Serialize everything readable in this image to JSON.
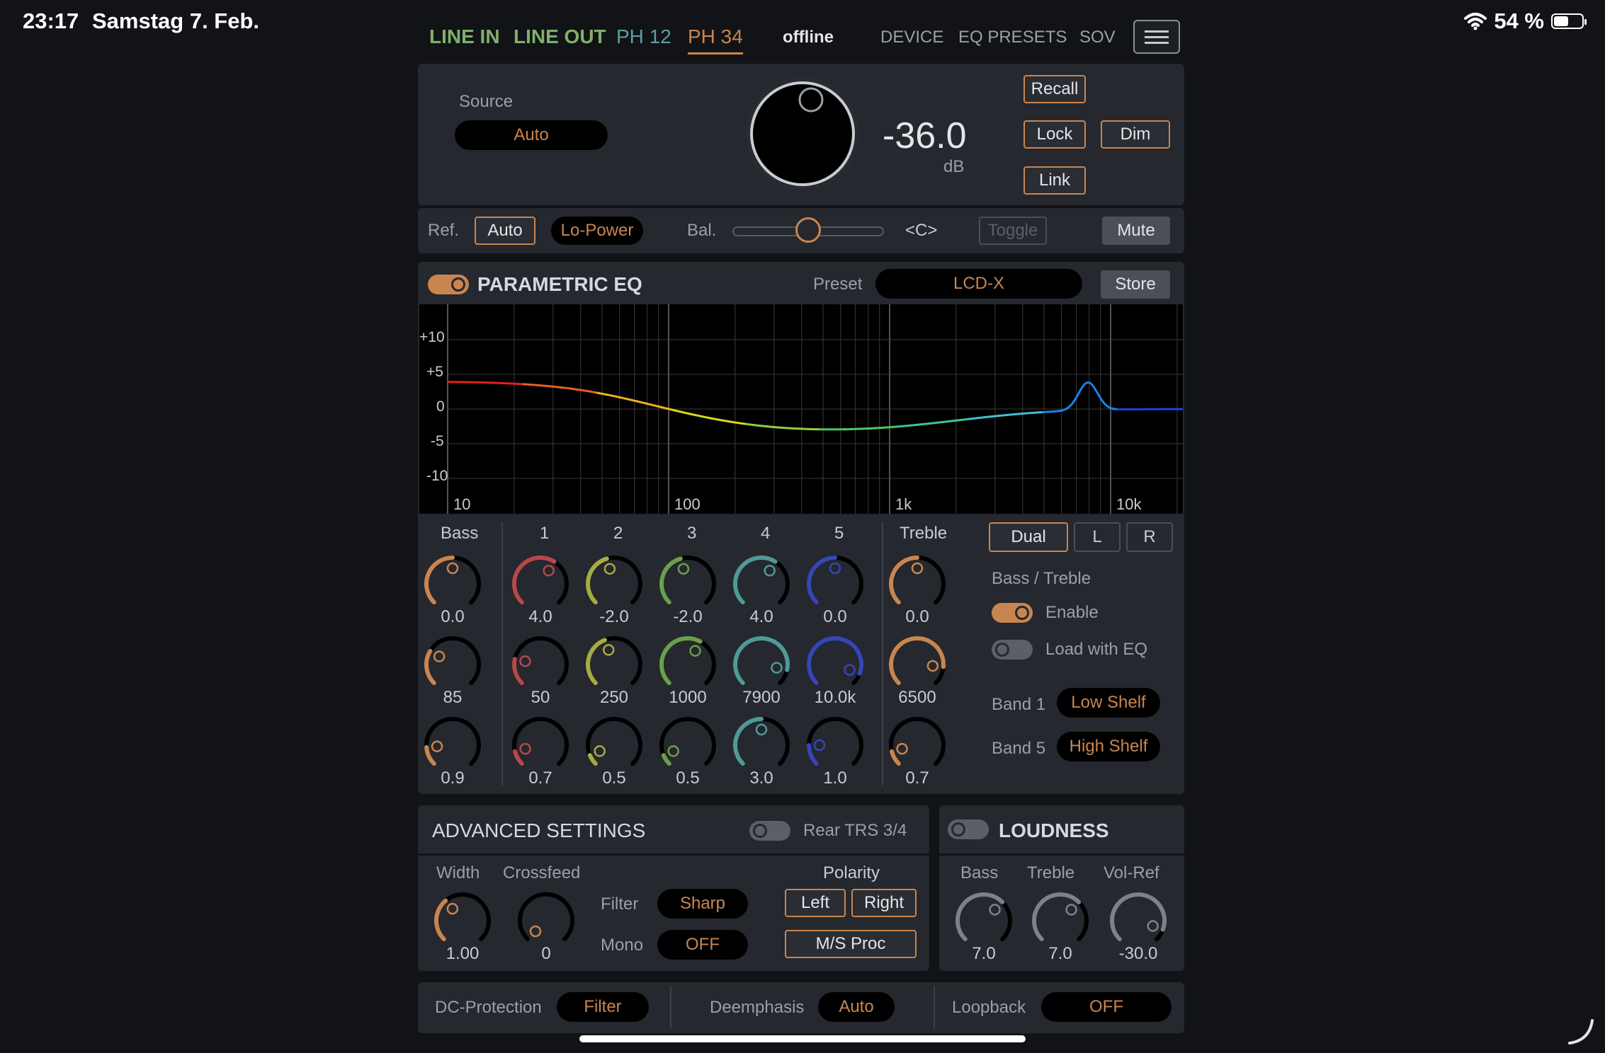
{
  "status": {
    "time": "23:17",
    "date": "Samstag 7. Feb.",
    "battery": "54 %"
  },
  "tabs": [
    {
      "label": "LINE IN",
      "color": "#7fb069"
    },
    {
      "label": "LINE OUT",
      "color": "#7fb069"
    },
    {
      "label": "PH 12",
      "color": "#5f9ea0"
    },
    {
      "label": "PH 34",
      "color": "#c98550"
    },
    {
      "label": "offline",
      "color": "#e3e5e8"
    },
    {
      "label": "DEVICE",
      "color": "#9aa0a8"
    },
    {
      "label": "EQ PRESETS",
      "color": "#9aa0a8"
    },
    {
      "label": "SOV",
      "color": "#9aa0a8"
    }
  ],
  "volume": {
    "source_label": "Source",
    "source_value": "Auto",
    "level": "-36.0",
    "unit": "dB",
    "buttons": {
      "recall": "Recall",
      "lock": "Lock",
      "dim": "Dim",
      "link": "Link"
    },
    "ref_label": "Ref.",
    "ref_value": "Auto",
    "lo_power": "Lo-Power",
    "bal_label": "Bal.",
    "bal_value": "<C>",
    "balance_position": 0.5,
    "toggle": "Toggle",
    "mute": "Mute"
  },
  "eq": {
    "title": "PARAMETRIC EQ",
    "preset_label": "Preset",
    "preset_value": "LCD-X",
    "store": "Store",
    "y_ticks": [
      "+10",
      "+5",
      "0",
      "-5",
      "-10"
    ],
    "x_ticks": [
      "10",
      "100",
      "1k",
      "10k"
    ],
    "bass_label": "Bass",
    "treble_label": "Treble",
    "band_numbers": [
      "1",
      "2",
      "3",
      "4",
      "5"
    ],
    "bass": {
      "gain": "0.0",
      "freq": "85",
      "q": "0.9",
      "color": "#c98550"
    },
    "bands": [
      {
        "gain": "4.0",
        "freq": "50",
        "q": "0.7",
        "color": "#b8474a"
      },
      {
        "gain": "-2.0",
        "freq": "250",
        "q": "0.5",
        "color": "#a8aa48"
      },
      {
        "gain": "-2.0",
        "freq": "1000",
        "q": "0.5",
        "color": "#6aa04a"
      },
      {
        "gain": "4.0",
        "freq": "7900",
        "q": "3.0",
        "color": "#4f9a97"
      },
      {
        "gain": "0.0",
        "freq": "10.0k",
        "q": "1.0",
        "color": "#3546b8"
      }
    ],
    "treble": {
      "gain": "0.0",
      "freq": "6500",
      "q": "0.7",
      "color": "#c98550"
    },
    "channel": {
      "dual": "Dual",
      "left": "L",
      "right": "R"
    },
    "bass_treble_label": "Bass / Treble",
    "enable_label": "Enable",
    "load_with_eq_label": "Load with EQ",
    "band1_label": "Band 1",
    "band1_value": "Low Shelf",
    "band5_label": "Band 5",
    "band5_value": "High Shelf"
  },
  "advanced": {
    "title": "ADVANCED SETTINGS",
    "rear_label": "Rear TRS 3/4",
    "width_label": "Width",
    "width_value": "1.00",
    "crossfeed_label": "Crossfeed",
    "crossfeed_value": "0",
    "filter_label": "Filter",
    "filter_value": "Sharp",
    "mono_label": "Mono",
    "mono_value": "OFF",
    "polarity_label": "Polarity",
    "left": "Left",
    "right": "Right",
    "ms_proc": "M/S Proc"
  },
  "loudness": {
    "title": "LOUDNESS",
    "bass_label": "Bass",
    "bass_value": "7.0",
    "treble_label": "Treble",
    "treble_value": "7.0",
    "volref_label": "Vol-Ref",
    "volref_value": "-30.0"
  },
  "footer": {
    "dc_label": "DC-Protection",
    "dc_value": "Filter",
    "deemph_label": "Deemphasis",
    "deemph_value": "Auto",
    "loopback_label": "Loopback",
    "loopback_value": "OFF"
  },
  "colors": {
    "accent": "#c98550",
    "panel": "#25282e",
    "background": "#111317"
  }
}
